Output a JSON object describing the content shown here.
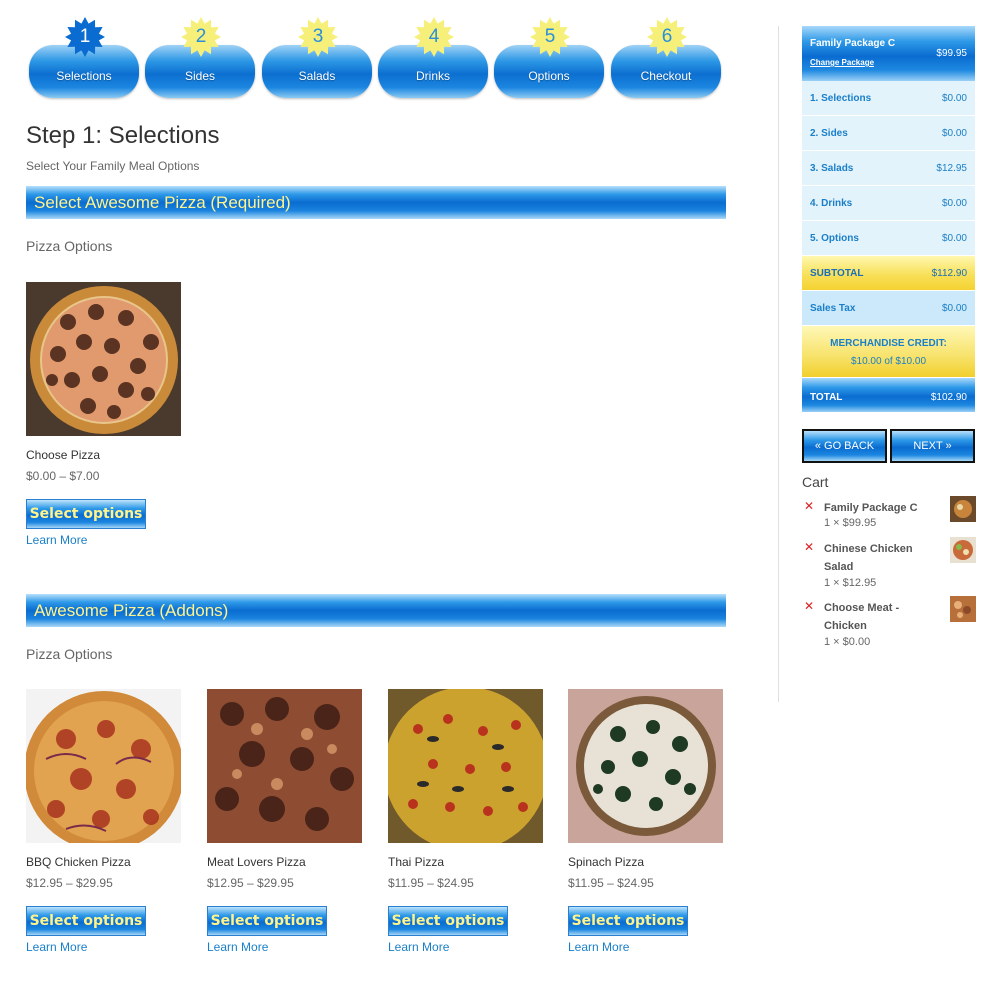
{
  "steps": [
    {
      "num": "1",
      "label": "Selections",
      "active": true
    },
    {
      "num": "2",
      "label": "Sides",
      "active": false
    },
    {
      "num": "3",
      "label": "Salads",
      "active": false
    },
    {
      "num": "4",
      "label": "Drinks",
      "active": false
    },
    {
      "num": "5",
      "label": "Options",
      "active": false
    },
    {
      "num": "6",
      "label": "Checkout",
      "active": false
    }
  ],
  "page": {
    "title": "Step 1: Selections",
    "subtitle": "Select Your Family Meal Options"
  },
  "sections": [
    {
      "heading": "Select Awesome Pizza (Required)",
      "subheading": "Pizza Options",
      "products": [
        {
          "name": "Choose Pizza",
          "price": "$0.00 – $7.00",
          "button": "Select options",
          "link": "Learn More"
        }
      ]
    },
    {
      "heading": "Awesome Pizza (Addons)",
      "subheading": "Pizza Options",
      "products": [
        {
          "name": "BBQ Chicken Pizza",
          "price": "$12.95 – $29.95",
          "button": "Select options",
          "link": "Learn More"
        },
        {
          "name": "Meat Lovers Pizza",
          "price": "$12.95 – $29.95",
          "button": "Select options",
          "link": "Learn More"
        },
        {
          "name": "Thai Pizza",
          "price": "$11.95 – $24.95",
          "button": "Select options",
          "link": "Learn More"
        },
        {
          "name": "Spinach Pizza",
          "price": "$11.95 – $24.95",
          "button": "Select options",
          "link": "Learn More"
        }
      ]
    }
  ],
  "summary": {
    "package_name": "Family Package C",
    "package_price": "$99.95",
    "change_label": "Change Package",
    "rows": [
      {
        "label": "1. Selections",
        "value": "$0.00"
      },
      {
        "label": "2. Sides",
        "value": "$0.00"
      },
      {
        "label": "3. Salads",
        "value": "$12.95"
      },
      {
        "label": "4. Drinks",
        "value": "$0.00"
      },
      {
        "label": "5. Options",
        "value": "$0.00"
      }
    ],
    "subtotal_label": "SUBTOTAL",
    "subtotal_value": "$112.90",
    "tax_label": "Sales Tax",
    "tax_value": "$0.00",
    "credit_label": "MERCHANDISE CREDIT:",
    "credit_value": "$10.00 of $10.00",
    "total_label": "TOTAL",
    "total_value": "$102.90"
  },
  "nav": {
    "back_label": "« GO BACK",
    "next_label": "NEXT »"
  },
  "cart": {
    "title": "Cart",
    "items": [
      {
        "name": "Family Package C",
        "qty": "1 × $99.95"
      },
      {
        "name": "Chinese Chicken Salad",
        "qty": "1 × $12.95"
      },
      {
        "name": "Choose Meat - Chicken",
        "qty": "1 × $0.00"
      }
    ]
  },
  "colors": {
    "accent_blue": "#0a6cd0",
    "heading_yellow": "#fff48c",
    "link_blue": "#1a7fc8",
    "remove_red": "#e02020",
    "subtotal_yellow": "#f8e05a"
  }
}
